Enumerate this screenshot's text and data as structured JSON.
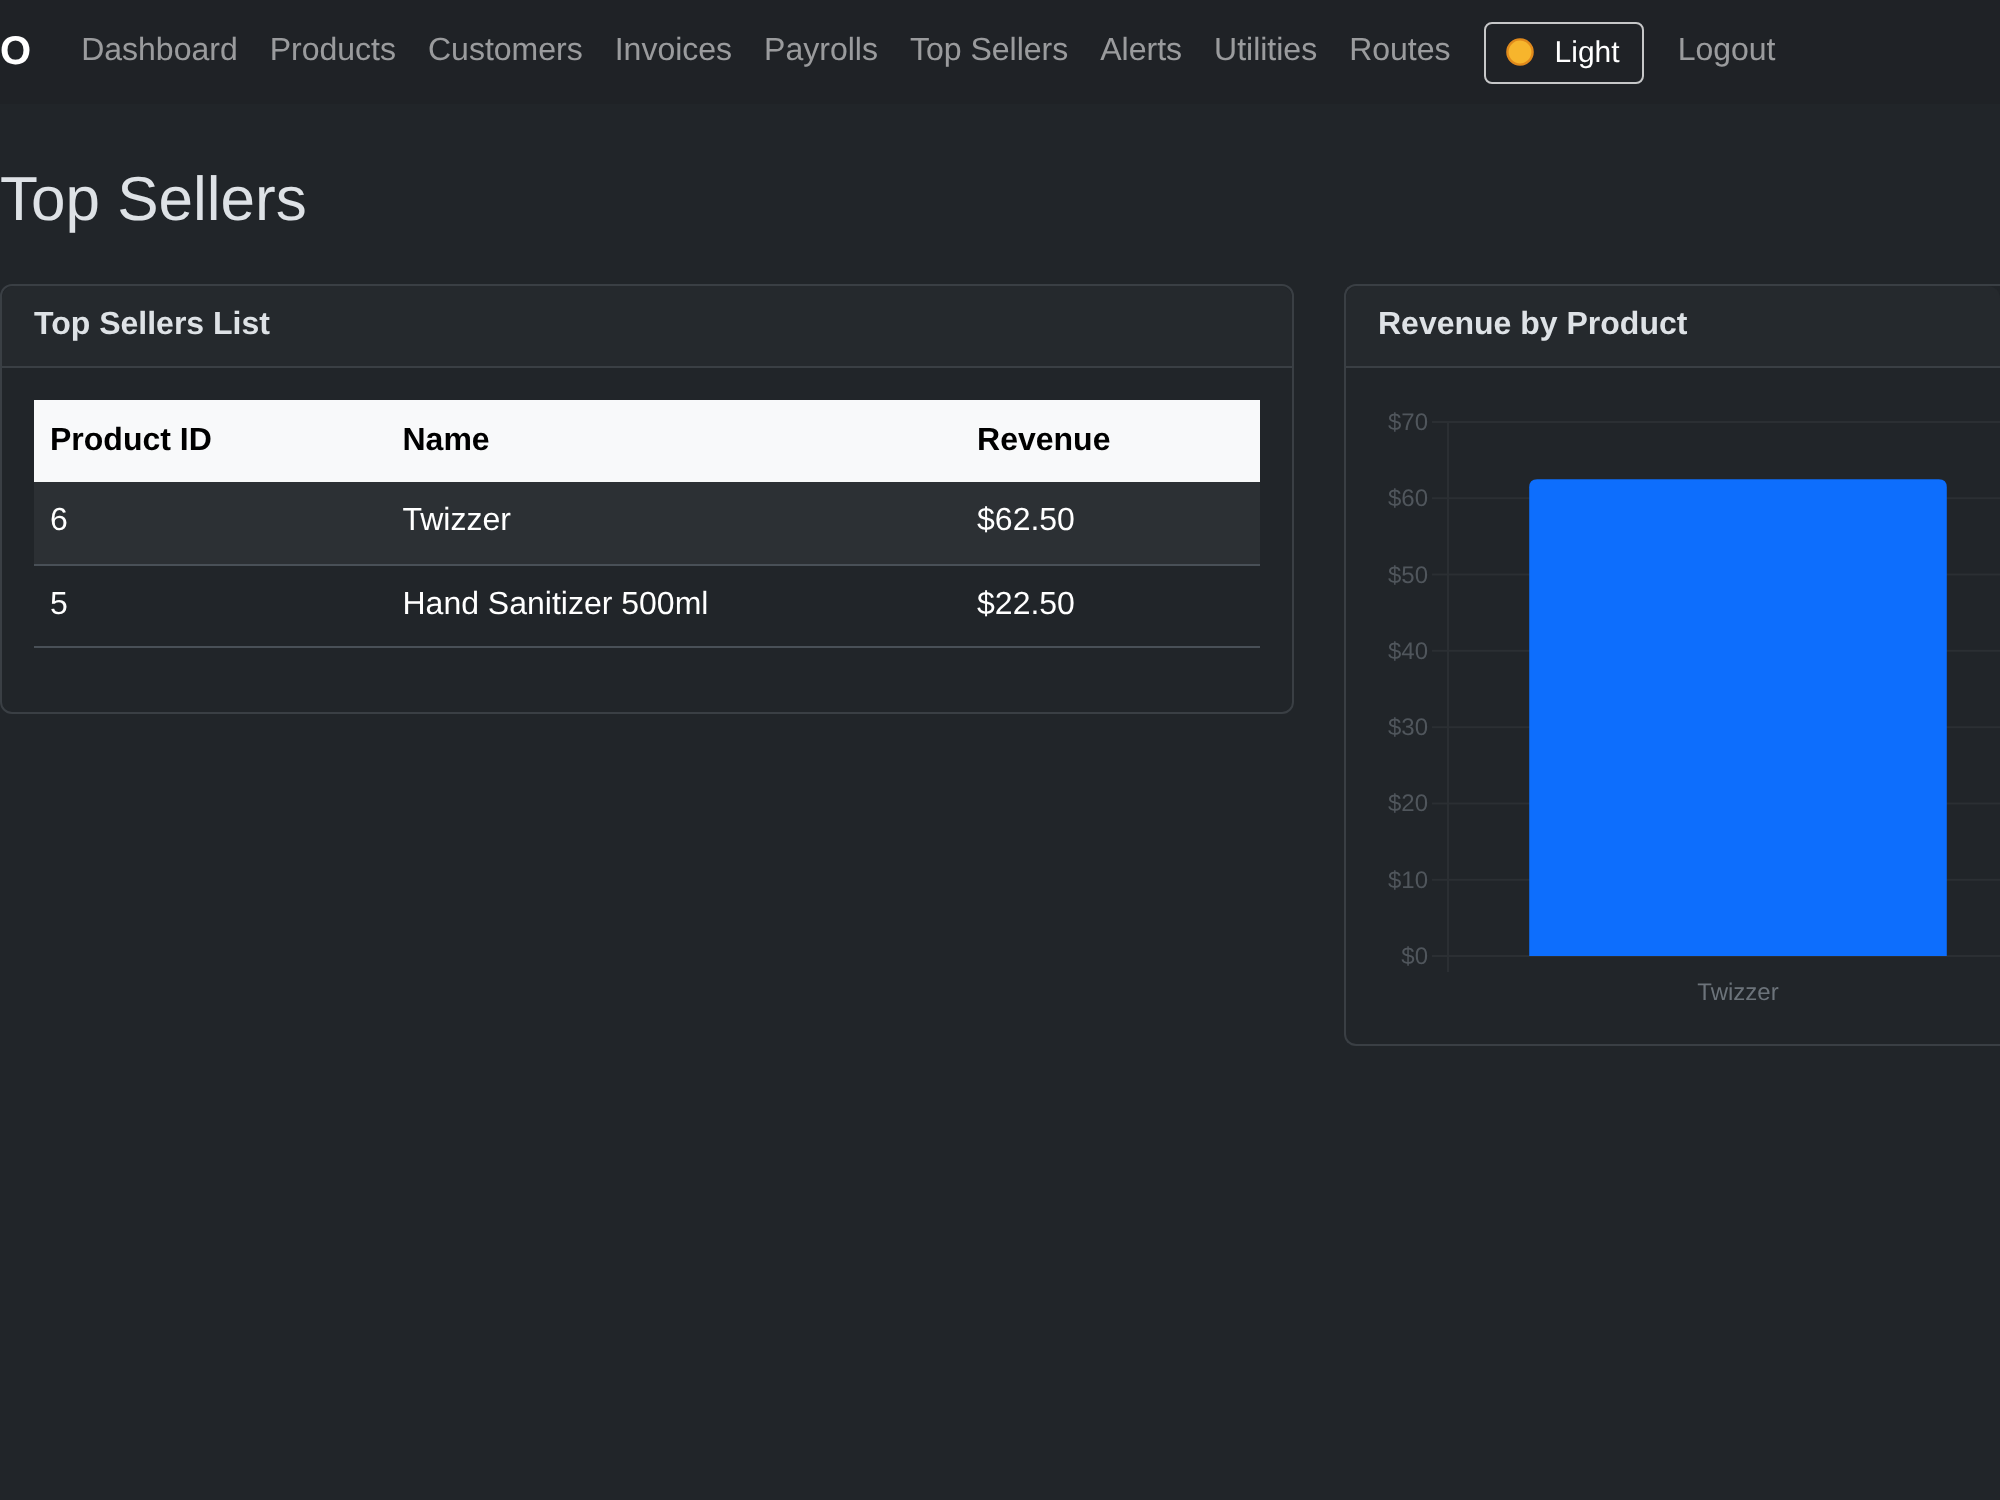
{
  "navbar": {
    "brand": "O",
    "links": [
      {
        "label": "Dashboard"
      },
      {
        "label": "Products"
      },
      {
        "label": "Customers"
      },
      {
        "label": "Invoices"
      },
      {
        "label": "Payrolls"
      },
      {
        "label": "Top Sellers"
      },
      {
        "label": "Alerts"
      },
      {
        "label": "Utilities"
      },
      {
        "label": "Routes"
      }
    ],
    "theme_toggle": {
      "label": "Light"
    },
    "logout": "Logout"
  },
  "page_title": "Top Sellers",
  "top_sellers_card": {
    "title": "Top Sellers List",
    "table": {
      "columns": [
        "Product ID",
        "Name",
        "Revenue"
      ],
      "rows": [
        [
          "6",
          "Twizzer",
          "$62.50"
        ],
        [
          "5",
          "Hand Sanitizer 500ml",
          "$22.50"
        ]
      ]
    }
  },
  "revenue_card": {
    "title": "Revenue by Product",
    "chart_data": {
      "type": "bar",
      "grid": true,
      "categories": [
        "Twizzer"
      ],
      "values": [
        62.5
      ],
      "ylim": [
        0,
        70
      ],
      "yticks": [
        {
          "value": 0,
          "label": "$0"
        },
        {
          "value": 10,
          "label": "$10"
        },
        {
          "value": 20,
          "label": "$20"
        },
        {
          "value": 30,
          "label": "$30"
        },
        {
          "value": 40,
          "label": "$40"
        },
        {
          "value": 50,
          "label": "$50"
        },
        {
          "value": 60,
          "label": "$60"
        },
        {
          "value": 70,
          "label": "$70"
        }
      ]
    }
  }
}
